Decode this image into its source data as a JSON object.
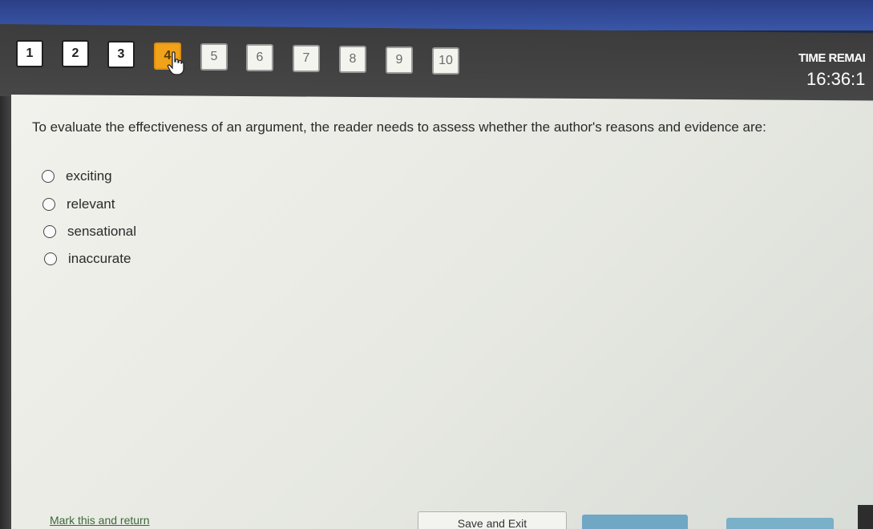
{
  "header": {
    "question_numbers": [
      "1",
      "2",
      "3",
      "4",
      "5",
      "6",
      "7",
      "8",
      "9",
      "10"
    ],
    "current_question": "4",
    "timer_label": "TIME REMAI",
    "timer_value": "16:36:1"
  },
  "question": {
    "text": "To evaluate the effectiveness of an argument, the reader needs to assess whether the author's reasons and evidence are:",
    "options": [
      "exciting",
      "relevant",
      "sensational",
      "inaccurate"
    ]
  },
  "footer": {
    "mark_label": "Mark this and return",
    "save_label": "Save and Exit"
  },
  "colors": {
    "current_question": "#f0a21a",
    "nav_bar": "#444444",
    "next_button": "#6fa7c4"
  },
  "icons": {
    "cursor": "hand-pointer-icon"
  }
}
